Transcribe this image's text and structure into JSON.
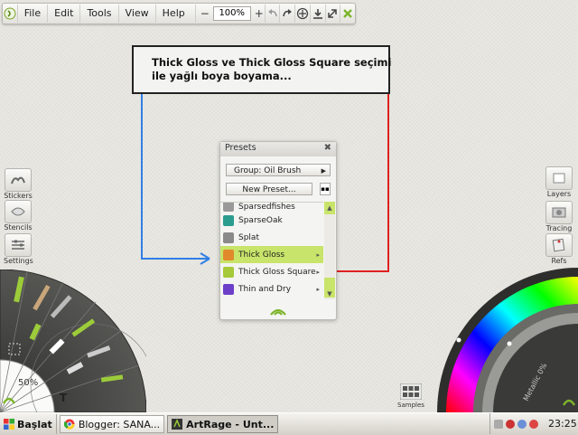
{
  "menubar": {
    "items": [
      "File",
      "Edit",
      "Tools",
      "View",
      "Help"
    ],
    "zoom_minus": "−",
    "zoom_value": "100%",
    "zoom_plus": "+",
    "tool_icons": [
      "undo-icon",
      "redo-icon",
      "move-icon",
      "download-icon",
      "expand-icon",
      "clear-icon"
    ]
  },
  "annotation": {
    "line1": "Thick Gloss ve Thick Gloss Square seçimi",
    "line2": "ile yağlı boya boyama..."
  },
  "left_tools": {
    "stickers": "Stickers",
    "stencils": "Stencils",
    "settings": "Settings"
  },
  "right_tools": {
    "layers": "Layers",
    "tracing": "Tracing",
    "refs": "Refs"
  },
  "presets": {
    "title": "Presets",
    "close": "✖",
    "group": "Group: Oil Brush",
    "new_preset": "New Preset...",
    "items": [
      {
        "label": "Sparsedfishes",
        "color": "#9a9a9a"
      },
      {
        "label": "SparseOak",
        "color": "#2a9d8f"
      },
      {
        "label": "Splat",
        "color": "#8a8a8a"
      },
      {
        "label": "Thick Gloss",
        "color": "#e08a2c"
      },
      {
        "label": "Thick Gloss Square",
        "color": "#a6c93a"
      },
      {
        "label": "Thin and Dry",
        "color": "#6c3fc9"
      }
    ],
    "selected": "Thick Gloss"
  },
  "toolwheel": {
    "zoom": "50%"
  },
  "colorwheel": {
    "metallic": "Metallic 0%"
  },
  "samples": "Samples",
  "taskbar": {
    "start": "Başlat",
    "tasks": [
      {
        "label": "Blogger: SANA...",
        "active": false
      },
      {
        "label": "ArtRage - Unt...",
        "active": true
      }
    ],
    "clock": "23:25"
  },
  "colors": {
    "accent_green": "#c8e46a",
    "arrow_blue": "#2f7fe6",
    "arrow_red": "#e02020"
  }
}
